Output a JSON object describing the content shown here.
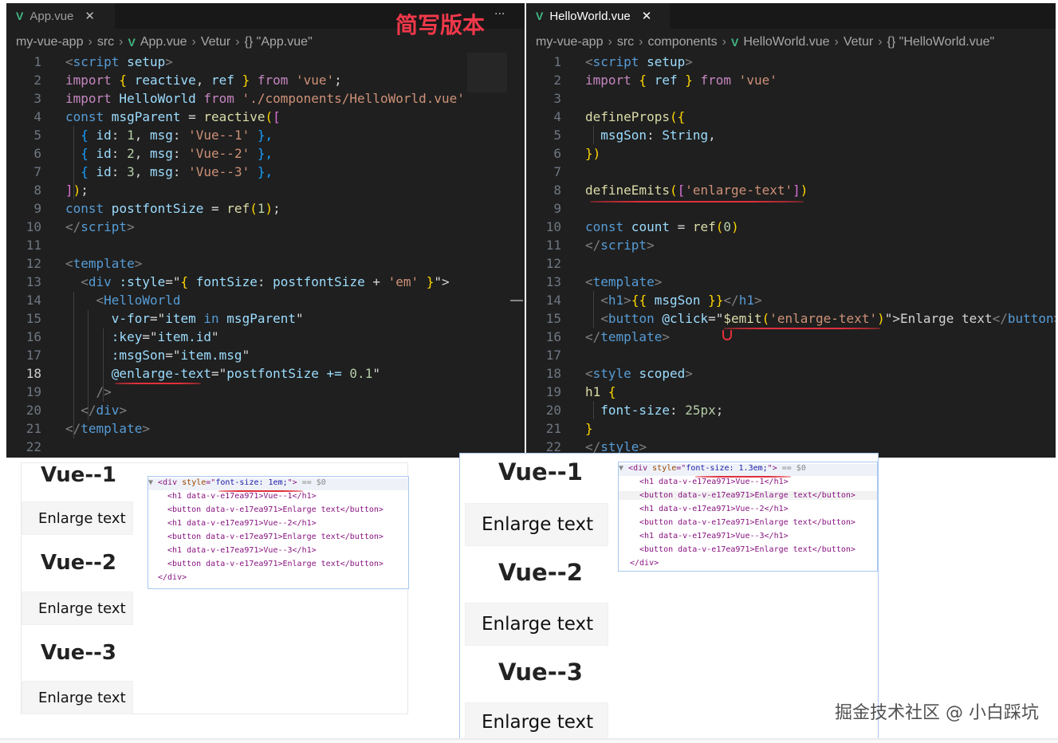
{
  "left_editor": {
    "tab_label": "App.vue",
    "tab_close": "✕",
    "annotation": "简写版本",
    "more": "···",
    "breadcrumb": [
      "my-vue-app",
      "src",
      "App.vue",
      "Vetur",
      "{} \"App.vue\""
    ],
    "line_numbers": [
      "1",
      "2",
      "3",
      "4",
      "5",
      "6",
      "7",
      "8",
      "9",
      "10",
      "11",
      "12",
      "13",
      "14",
      "15",
      "16",
      "17",
      "18",
      "19",
      "20",
      "21",
      "22"
    ],
    "code": {
      "l1a": "<",
      "l1b": "script",
      "l1c": " setup",
      "l1d": ">",
      "l2a": "import",
      "l2b": " { ",
      "l2c": "reactive",
      "l2d": ", ",
      "l2e": "ref",
      "l2f": " } ",
      "l2g": "from",
      "l2h": " 'vue'",
      "l2i": ";",
      "l3a": "import",
      "l3b": " HelloWorld ",
      "l3c": "from",
      "l3d": " './components/HelloWorld.vue'",
      "l4a": "const",
      "l4b": " msgParent ",
      "l4c": "= ",
      "l4d": "reactive",
      "l4e": "(",
      "l4f": "[",
      "l5a": "  { ",
      "l5b": "id",
      "l5c": ": ",
      "l5d": "1",
      "l5e": ", ",
      "l5f": "msg",
      "l5g": ": ",
      "l5h": "'Vue--1'",
      "l5i": " },",
      "l6a": "  { ",
      "l6b": "id",
      "l6c": ": ",
      "l6d": "2",
      "l6e": ", ",
      "l6f": "msg",
      "l6g": ": ",
      "l6h": "'Vue--2'",
      "l6i": " },",
      "l7a": "  { ",
      "l7b": "id",
      "l7c": ": ",
      "l7d": "3",
      "l7e": ", ",
      "l7f": "msg",
      "l7g": ": ",
      "l7h": "'Vue--3'",
      "l7i": " },",
      "l8a": "]",
      "l8b": ")",
      "l8c": ";",
      "l9a": "const",
      "l9b": " postfontSize ",
      "l9c": "= ",
      "l9d": "ref",
      "l9e": "(",
      "l9f": "1",
      "l9g": ")",
      "l9h": ";",
      "l10a": "</",
      "l10b": "script",
      "l10c": ">",
      "l12a": "<",
      "l12b": "template",
      "l12c": ">",
      "l13a": "  <",
      "l13b": "div",
      "l13c": " :style",
      "l13d": "=\"",
      "l13e": "{ ",
      "l13f": "fontSize",
      "l13g": ": ",
      "l13h": "postfontSize",
      "l13i": " + ",
      "l13j": "'em'",
      "l13k": " }",
      "l13l": "\">",
      "l14a": "    <",
      "l14b": "HelloWorld",
      "l15a": "      v-for",
      "l15b": "=\"",
      "l15c": "item",
      "l15d": " in ",
      "l15e": "msgParent",
      "l15f": "\"",
      "l16a": "      :key",
      "l16b": "=\"",
      "l16c": "item.id",
      "l16d": "\"",
      "l17a": "      :msgSon",
      "l17b": "=\"",
      "l17c": "item.msg",
      "l17d": "\"",
      "l18a": "      @enlarge-text",
      "l18b": "=\"",
      "l18c": "postfontSize += ",
      "l18d": "0.1",
      "l18e": "\"",
      "l19a": "    />",
      "l20a": "  </",
      "l20b": "div",
      "l20c": ">",
      "l21a": "</",
      "l21b": "template",
      "l21c": ">"
    }
  },
  "right_editor": {
    "tab_label": "HelloWorld.vue",
    "tab_close": "✕",
    "breadcrumb": [
      "my-vue-app",
      "src",
      "components",
      "HelloWorld.vue",
      "Vetur",
      "{} \"HelloWorld.vue\""
    ],
    "line_numbers": [
      "1",
      "2",
      "3",
      "4",
      "5",
      "6",
      "7",
      "8",
      "9",
      "10",
      "11",
      "12",
      "13",
      "14",
      "15",
      "16",
      "17",
      "18",
      "19",
      "20",
      "21",
      "22"
    ],
    "code": {
      "r1a": "<",
      "r1b": "script",
      "r1c": " setup",
      "r1d": ">",
      "r2a": "import",
      "r2b": " { ",
      "r2c": "ref",
      "r2d": " } ",
      "r2e": "from",
      "r2f": " 'vue'",
      "r4a": "defineProps",
      "r4b": "({",
      "r5a": "  msgSon",
      "r5b": ": ",
      "r5c": "String",
      ",": ",",
      "r6a": "})",
      "r8a": "defineEmits",
      "r8b": "(",
      "r8c": "[",
      "r8d": "'enlarge-text'",
      "r8e": "]",
      "r8f": ")",
      "r10a": "const",
      "r10b": " count ",
      "r10c": "= ",
      "r10d": "ref",
      "r10e": "(",
      "r10f": "0",
      "r10g": ")",
      "r11a": "</",
      "r11b": "script",
      "r11c": ">",
      "r13a": "<",
      "r13b": "template",
      "r13c": ">",
      "r14a": "  <",
      "r14b": "h1",
      "r14c": ">",
      "r14d": "{{ ",
      "r14e": "msgSon",
      "r14f": " }}",
      "r14g": "</",
      "r14h": "h1",
      "r14i": ">",
      "r15a": "  <",
      "r15b": "button",
      "r15c": " @click",
      "r15d": "=\"",
      "r15e": "$emit",
      "r15f": "(",
      "r15g": "'enlarge-text'",
      "r15h": ")",
      "r15i": "\">",
      "r15j": "Enlarge text",
      "r15k": "</",
      "r15l": "button",
      "r15m": ">",
      "r16a": "</",
      "r16b": "template",
      "r16c": ">",
      "r18a": "<",
      "r18b": "style",
      "r18c": " scoped",
      "r18d": ">",
      "r19a": "h1",
      "r19b": " {",
      "r20a": "  font-size",
      "r20b": ": ",
      "r20c": "25px",
      ";": ";",
      "r21a": "}",
      "r22a": "</",
      "r22b": "style",
      "r22c": ">"
    }
  },
  "left_preview": {
    "items": [
      "Vue--1",
      "Enlarge text",
      "Vue--2",
      "Enlarge text",
      "Vue--3",
      "Enlarge text"
    ],
    "dom": {
      "d0a": "▼ ",
      "d0b": "<div ",
      "d0c": "style",
      "d0d": "=\"",
      "d0e": "font-size: 1em;",
      "d0f": "\">",
      "d0g": " == $0",
      "d1": "<h1 data-v-e17ea971>Vue--1</h1>",
      "d2": "<button data-v-e17ea971>Enlarge text</button>",
      "d3": "<h1 data-v-e17ea971>Vue--2</h1>",
      "d4": "<button data-v-e17ea971>Enlarge text</button>",
      "d5": "<h1 data-v-e17ea971>Vue--3</h1>",
      "d6": "<button data-v-e17ea971>Enlarge text</button>",
      "d7": "</div>"
    }
  },
  "right_preview": {
    "items": [
      "Vue--1",
      "Enlarge text",
      "Vue--2",
      "Enlarge text",
      "Vue--3",
      "Enlarge text"
    ],
    "dom": {
      "d0a": "▼ ",
      "d0b": "<div ",
      "d0c": "style",
      "d0d": "=\"",
      "d0e": "font-size: 1.3em;",
      "d0f": "\">",
      "d0g": " == $0",
      "d1": "<h1 data-v-e17ea971>Vue--1</h1>",
      "d2": "<button data-v-e17ea971>Enlarge text</button>",
      "d3": "<h1 data-v-e17ea971>Vue--2</h1>",
      "d4": "<button data-v-e17ea971>Enlarge text</button>",
      "d5": "<h1 data-v-e17ea971>Vue--3</h1>",
      "d6": "<button data-v-e17ea971>Enlarge text</button>",
      "d7": "</div>"
    }
  },
  "watermark": "掘金技术社区 @ 小白踩坑",
  "colors": {
    "editor_bg": "#1f1f1f",
    "annotation": "#f0384a",
    "vue_green": "#41b883",
    "underline_red": "#e1303c"
  }
}
